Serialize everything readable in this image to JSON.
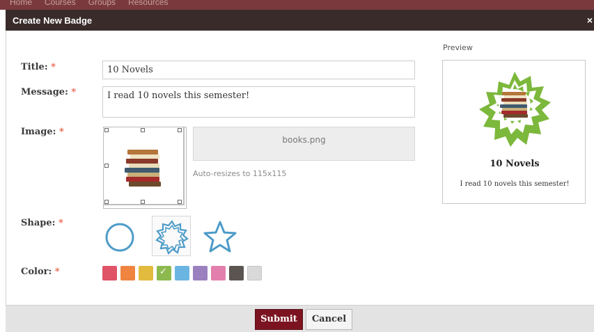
{
  "nav": {
    "items": [
      "Home",
      "Courses",
      "Groups",
      "Resources"
    ]
  },
  "modal": {
    "title": "Create New Badge",
    "close": "×"
  },
  "form": {
    "title_label": "Title:",
    "title_value": "10 Novels",
    "message_label": "Message:",
    "message_value": "I read 10 novels this semester!",
    "image_label": "Image:",
    "image_file": "books.png",
    "image_hint": "Auto-resizes to 115x115",
    "shape_label": "Shape:",
    "shapes": [
      "circle",
      "burst",
      "star"
    ],
    "selected_shape": "burst",
    "color_label": "Color:",
    "colors": [
      "#e05468",
      "#ef8440",
      "#e2bb3e",
      "#8dba4f",
      "#6bb5e2",
      "#9b80bf",
      "#e37fac",
      "#5b5551",
      "#d9d9d9"
    ],
    "selected_color": "#8dba4f",
    "required_mark": "*"
  },
  "preview": {
    "label": "Preview",
    "title": "10 Novels",
    "message": "I read 10 novels this semester!"
  },
  "footer": {
    "submit_label": "Submit",
    "cancel_label": "Cancel"
  },
  "theme": {
    "accent": "#7b1420",
    "header": "#3a2b2b",
    "shape_stroke": "#4d9bc8",
    "badge_green": "#7cb83c"
  }
}
